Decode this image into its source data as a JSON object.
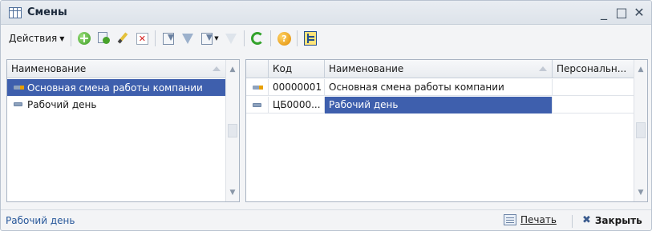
{
  "window": {
    "title": "Смены",
    "controls": {
      "minimize": "_",
      "maximize": "□",
      "close": "✕"
    }
  },
  "toolbar": {
    "actions_label": "Действия",
    "buttons": [
      {
        "name": "add-icon",
        "tooltip": ""
      },
      {
        "name": "copy-icon",
        "tooltip": ""
      },
      {
        "name": "edit-icon",
        "tooltip": ""
      },
      {
        "name": "delete-icon",
        "tooltip": ""
      },
      {
        "name": "filter-icon",
        "tooltip": ""
      },
      {
        "name": "funnel-icon",
        "tooltip": ""
      },
      {
        "name": "filter-menu-icon",
        "tooltip": ""
      },
      {
        "name": "clear-filter-icon",
        "tooltip": ""
      },
      {
        "name": "refresh-icon",
        "tooltip": ""
      },
      {
        "name": "help-icon",
        "tooltip": ""
      },
      {
        "name": "tree-view-icon",
        "tooltip": ""
      }
    ],
    "help_glyph": "?"
  },
  "left_panel": {
    "header": "Наименование",
    "rows": [
      {
        "label": "Основная смена работы компании",
        "selected": true,
        "icon": "folder-icon"
      },
      {
        "label": "Рабочий день",
        "selected": false,
        "icon": "item-icon"
      }
    ]
  },
  "right_panel": {
    "columns": {
      "code": "Код",
      "name": "Наименование",
      "personal": "Персональн..."
    },
    "rows": [
      {
        "code": "00000001",
        "name": "Основная смена работы компании",
        "personal": "",
        "selected": false
      },
      {
        "code": "ЦБ0000...",
        "name": "Рабочий день",
        "personal": "",
        "selected": true
      }
    ]
  },
  "statusbar": {
    "text": "Рабочий день",
    "print_label": "Печать",
    "close_label": "Закрыть",
    "close_glyph": "✖"
  },
  "colors": {
    "selection": "#3e5fad",
    "accent_text": "#27579a",
    "window_bg": "#f3f4f6"
  }
}
